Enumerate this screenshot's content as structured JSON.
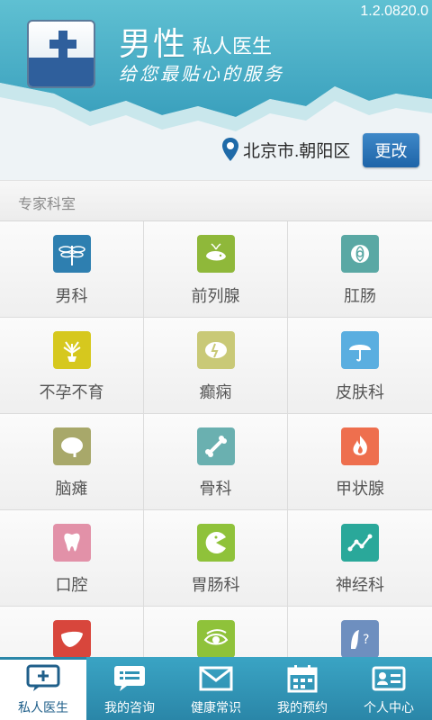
{
  "header": {
    "version": "1.2.0820.0",
    "title_main": "男性",
    "title_sub": "私人医生",
    "slogan": "给您最贴心的服务",
    "location": "北京市.朝阳区",
    "change_label": "更改"
  },
  "section": {
    "label": "专家科室"
  },
  "departments": [
    {
      "label": "男科",
      "icon": "dragonfly-icon",
      "color": "#2e7fb0"
    },
    {
      "label": "前列腺",
      "icon": "whale-icon",
      "color": "#8fb83a"
    },
    {
      "label": "肛肠",
      "icon": "flower-icon",
      "color": "#5aa8a4"
    },
    {
      "label": "不孕不育",
      "icon": "plant-icon",
      "color": "#d6c81e"
    },
    {
      "label": "癫痫",
      "icon": "brain-bolt-icon",
      "color": "#c9c977"
    },
    {
      "label": "皮肤科",
      "icon": "umbrella-icon",
      "color": "#5aaee0"
    },
    {
      "label": "脑瘫",
      "icon": "brain-icon",
      "color": "#a8a86a"
    },
    {
      "label": "骨科",
      "icon": "bone-icon",
      "color": "#6ab0b0"
    },
    {
      "label": "甲状腺",
      "icon": "flame-icon",
      "color": "#ee6f4e"
    },
    {
      "label": "口腔",
      "icon": "tooth-icon",
      "color": "#e291a8"
    },
    {
      "label": "胃肠科",
      "icon": "pacman-icon",
      "color": "#8fc23a"
    },
    {
      "label": "神经科",
      "icon": "nerve-icon",
      "color": "#2aa89a"
    },
    {
      "label": "",
      "icon": "liver-icon",
      "color": "#d8463c"
    },
    {
      "label": "",
      "icon": "eye-icon",
      "color": "#8fc23a"
    },
    {
      "label": "",
      "icon": "face-question-icon",
      "color": "#6e8fbf"
    }
  ],
  "nav": [
    {
      "label": "私人医生",
      "icon": "chat-plus-icon",
      "active": true
    },
    {
      "label": "我的咨询",
      "icon": "chat-list-icon",
      "active": false
    },
    {
      "label": "健康常识",
      "icon": "envelope-icon",
      "active": false
    },
    {
      "label": "我的预约",
      "icon": "calendar-icon",
      "active": false
    },
    {
      "label": "个人中心",
      "icon": "id-card-icon",
      "active": false
    }
  ]
}
